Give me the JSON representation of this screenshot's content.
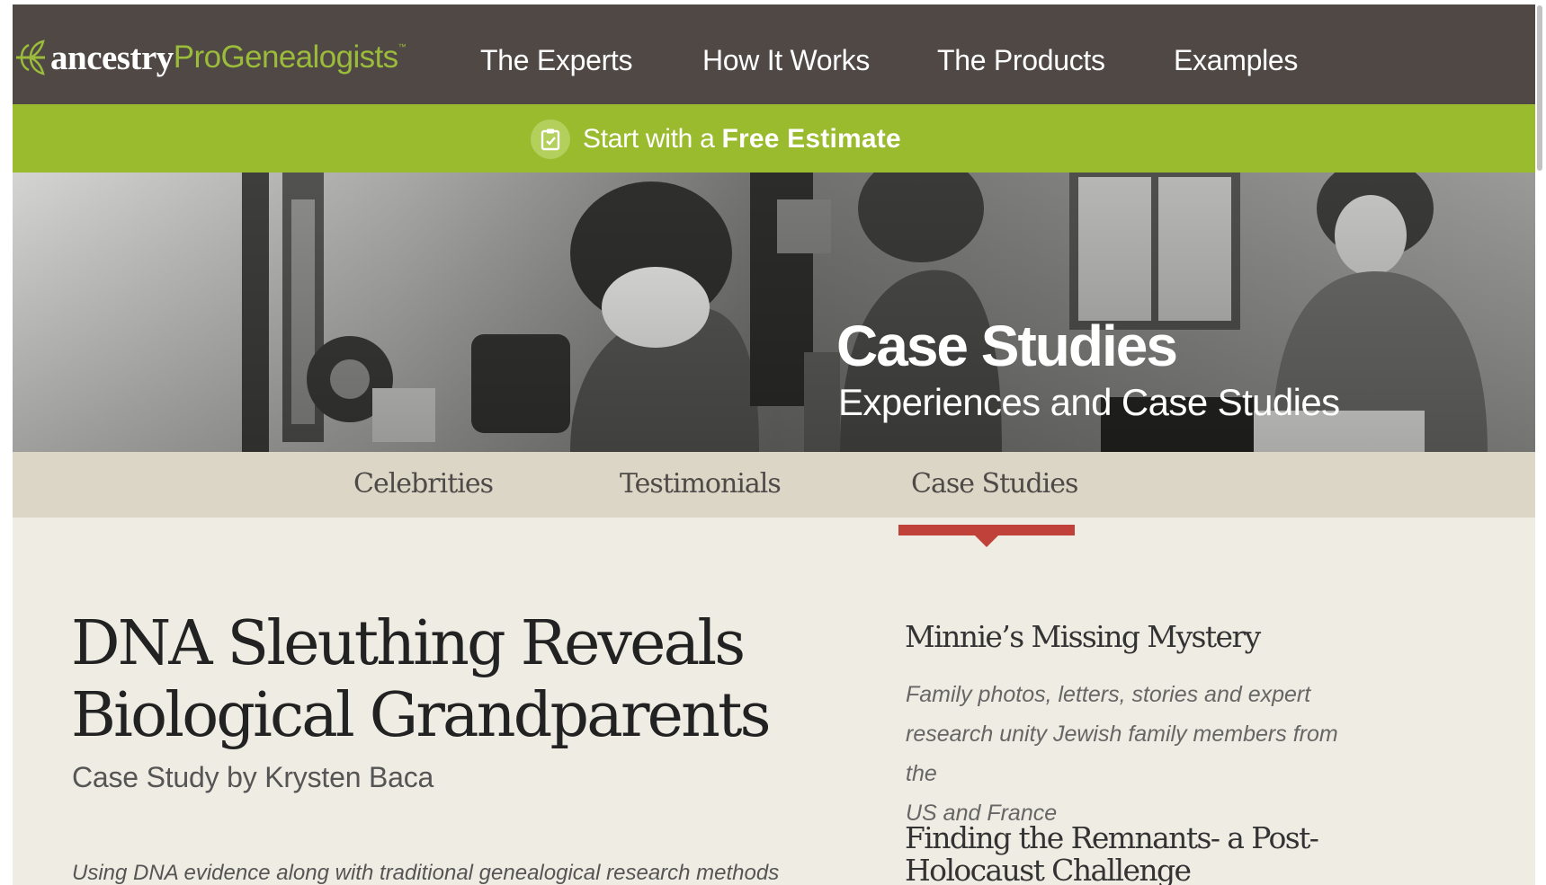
{
  "nav": {
    "logo_main": "ancestry",
    "logo_sub": "ProGenealogists",
    "logo_tm": "™",
    "items": [
      "The Experts",
      "How It Works",
      "The Products",
      "Examples"
    ]
  },
  "estimate": {
    "prefix": "Start with a",
    "emphasis": "Free Estimate",
    "icon": "clipboard-check-icon"
  },
  "hero": {
    "title": "Case Studies",
    "subtitle": "Experiences and Case Studies"
  },
  "subnav": {
    "items": [
      "Celebrities",
      "Testimonials",
      "Case Studies"
    ],
    "active": "Case Studies"
  },
  "article": {
    "title_line1": "DNA Sleuthing Reveals",
    "title_line2": "Biological Grandparents",
    "byline": "Case Study by Krysten Baca",
    "intro": "Using DNA evidence along with traditional genealogical research methods"
  },
  "sidebar": {
    "items": [
      {
        "title": "Minnie’s Missing Mystery",
        "desc_lines": [
          "Family photos, letters, stories and expert",
          "research unity Jewish family members from the",
          "US and France"
        ]
      },
      {
        "title_lines": [
          "Finding the Remnants- a Post-",
          "Holocaust Challenge"
        ]
      }
    ]
  },
  "colors": {
    "nav_bg": "#4f4844",
    "accent_green": "#9abb2e",
    "active_red": "#c0403a",
    "page_bg": "#efede3",
    "subnav_bg": "#dcd6c6"
  }
}
